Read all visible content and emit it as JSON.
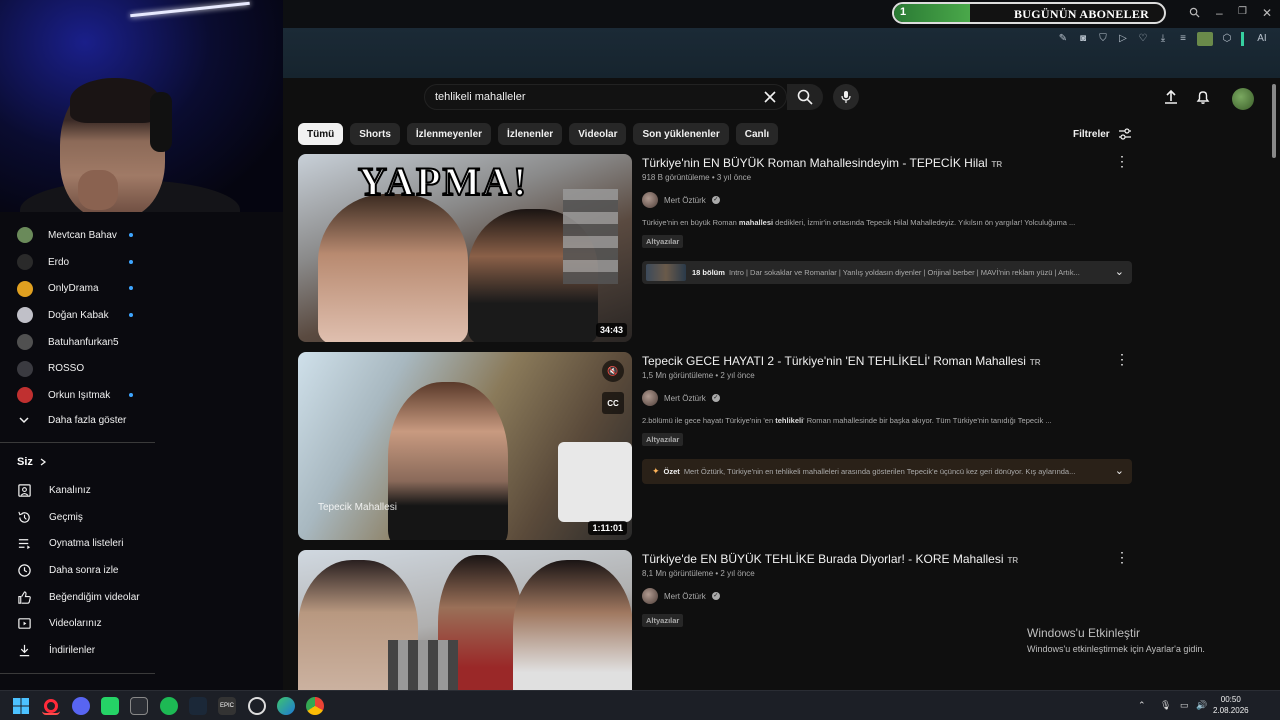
{
  "overlay": {
    "subs_counter": "1",
    "subs_label": "BUGÜNÜN ABONELER"
  },
  "search": {
    "query": "tehlikeli mahalleler"
  },
  "subscriptions": [
    {
      "name": "Mevtcan Bahav",
      "color": "#6a8a5a",
      "live": true
    },
    {
      "name": "Erdo",
      "color": "#2a2a2a",
      "live": true
    },
    {
      "name": "OnlyDrama",
      "color": "#e0a020",
      "live": true
    },
    {
      "name": "Doğan Kabak",
      "color": "#c0c0c8",
      "live": true
    },
    {
      "name": "Batuhanfurkan5",
      "color": "#505050",
      "live": false
    },
    {
      "name": "ROSSO",
      "color": "#3a3a40",
      "live": false
    },
    {
      "name": "Orkun Işıtmak",
      "color": "#c03030",
      "live": true
    }
  ],
  "show_more": "Daha fazla göster",
  "you_section": {
    "title": "Siz",
    "items": [
      {
        "label": "Kanalınız",
        "icon": "user-square-icon"
      },
      {
        "label": "Geçmiş",
        "icon": "history-icon"
      },
      {
        "label": "Oynatma listeleri",
        "icon": "playlist-icon"
      },
      {
        "label": "Daha sonra izle",
        "icon": "clock-icon"
      },
      {
        "label": "Beğendiğim videolar",
        "icon": "thumbs-up-icon"
      },
      {
        "label": "Videolarınız",
        "icon": "video-icon"
      },
      {
        "label": "İndirilenler",
        "icon": "download-icon"
      }
    ]
  },
  "chips": [
    "Tümü",
    "Shorts",
    "İzlenmeyenler",
    "İzlenenler",
    "Videolar",
    "Son yüklenenler",
    "Canlı"
  ],
  "filters_label": "Filtreler",
  "videos": [
    {
      "title": "Türkiye'nin EN BÜYÜK Roman Mahallesindeyim - TEPECİK Hilal",
      "lang": "TR",
      "meta": "918 B görüntüleme • 3 yıl önce",
      "channel": "Mert Öztürk",
      "desc_pre": "Türkiye'nin en büyük Roman ",
      "desc_bold": "mahallesi",
      "desc_post": " dedikleri, İzmir'in ortasında Tepecik Hilal Mahalledeyiz. Yıkılsın ön yargılar! Yolculuğuma ...",
      "badge": "Altyazılar",
      "duration": "34:43",
      "thumb_text": "YAPMA!",
      "chapters_count": "18 bölüm",
      "chapters_text": "Intro | Dar sokaklar ve Romanlar | Yanlış yoldasın diyenler | Orijinal berber | MAVİ'nin reklam yüzü | Artık..."
    },
    {
      "title": "Tepecik GECE HAYATI 2 - Türkiye'nin 'EN TEHLİKELİ' Roman Mahallesi",
      "lang": "TR",
      "meta": "1,5 Mn görüntüleme • 2 yıl önce",
      "channel": "Mert Öztürk",
      "desc_pre": "2.bölümü ile gece hayatı Türkiye'nin 'en ",
      "desc_bold": "tehlikeli",
      "desc_post": "' Roman mahallesinde bir başka akıyor. Tüm Türkiye'nin tanıdığı Tepecik ...",
      "badge": "Altyazılar",
      "duration": "1:11:01",
      "thumb_text": "Tepecik Mahallesi",
      "summary_label": "Özet",
      "summary_text": "Mert Öztürk, Türkiye'nin en tehlikeli mahalleleri arasında gösterilen Tepecik'e üçüncü kez geri dönüyor. Kış aylarında..."
    },
    {
      "title": "Türkiye'de EN BÜYÜK TEHLİKE Burada Diyorlar! - KORE Mahallesi",
      "lang": "TR",
      "meta": "8,1 Mn görüntüleme • 2 yıl önce",
      "channel": "Mert Öztürk",
      "badge": "Altyazılar"
    }
  ],
  "activation": {
    "line1": "Windows'u Etkinleştir",
    "line2": "Windows'u etkinleştirmek için Ayarlar'a gidin."
  },
  "clock": {
    "time": "00:50",
    "date": "2.08.2026"
  },
  "toolbar_ai": "AI"
}
